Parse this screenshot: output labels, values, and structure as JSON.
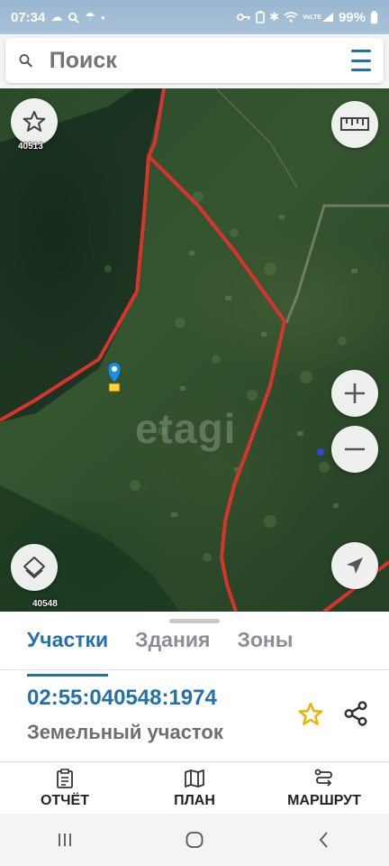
{
  "status": {
    "time": "07:34",
    "battery": "99%",
    "left_icons": [
      "cloud-icon",
      "search-icon",
      "umbrella-icon",
      "dot-icon"
    ],
    "right_icons": [
      "key-icon",
      "battery-saver-icon",
      "bluetooth-icon",
      "wifi-icon",
      "volte-icon",
      "signal-icon"
    ],
    "volte": "VoLTE"
  },
  "search": {
    "placeholder": "Поиск"
  },
  "map": {
    "watermark": "etagi",
    "label_top": "40513",
    "label_bottom": "40548",
    "buttons": [
      "favorites-star-icon",
      "ruler-icon",
      "zoom-in-icon",
      "zoom-out-icon",
      "layers-icon",
      "locate-icon"
    ]
  },
  "sheet": {
    "tabs": [
      "Участки",
      "Здания",
      "Зоны"
    ],
    "active_tab": 0,
    "cadastral_number": "02:55:040548:1974",
    "object_type": "Земельный участок"
  },
  "actions": {
    "report": "ОТЧЁТ",
    "plan": "ПЛАН",
    "route": "МАРШРУТ"
  },
  "colors": {
    "accent": "#2272a8",
    "boundary": "#d8342c",
    "star": "#f2c028"
  }
}
